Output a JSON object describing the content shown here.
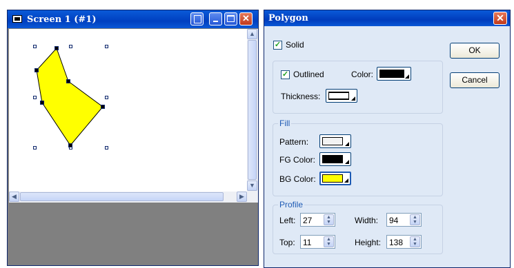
{
  "screen_window": {
    "title": "Screen 1 (#1)"
  },
  "dialog": {
    "title": "Polygon",
    "close_glyph": "✕",
    "solid": {
      "label": "Solid",
      "checked": true
    },
    "outline": {
      "outlined_label": "Outlined",
      "outlined_checked": true,
      "color_label": "Color:",
      "color": "#000000",
      "thickness_label": "Thickness:"
    },
    "fill": {
      "group_label": "Fill",
      "pattern_label": "Pattern:",
      "pattern_color": "#f3f3f3",
      "fg_label": "FG Color:",
      "fg_color": "#000000",
      "bg_label": "BG Color:",
      "bg_color": "#ffff00"
    },
    "profile": {
      "group_label": "Profile",
      "left_label": "Left:",
      "left_value": "27",
      "top_label": "Top:",
      "top_value": "11",
      "width_label": "Width:",
      "width_value": "94",
      "height_label": "Height:",
      "height_value": "138"
    },
    "ok_label": "OK",
    "cancel_label": "Cancel"
  },
  "polygon": {
    "fill_color": "#ffff00",
    "stroke_color": "#000000"
  }
}
